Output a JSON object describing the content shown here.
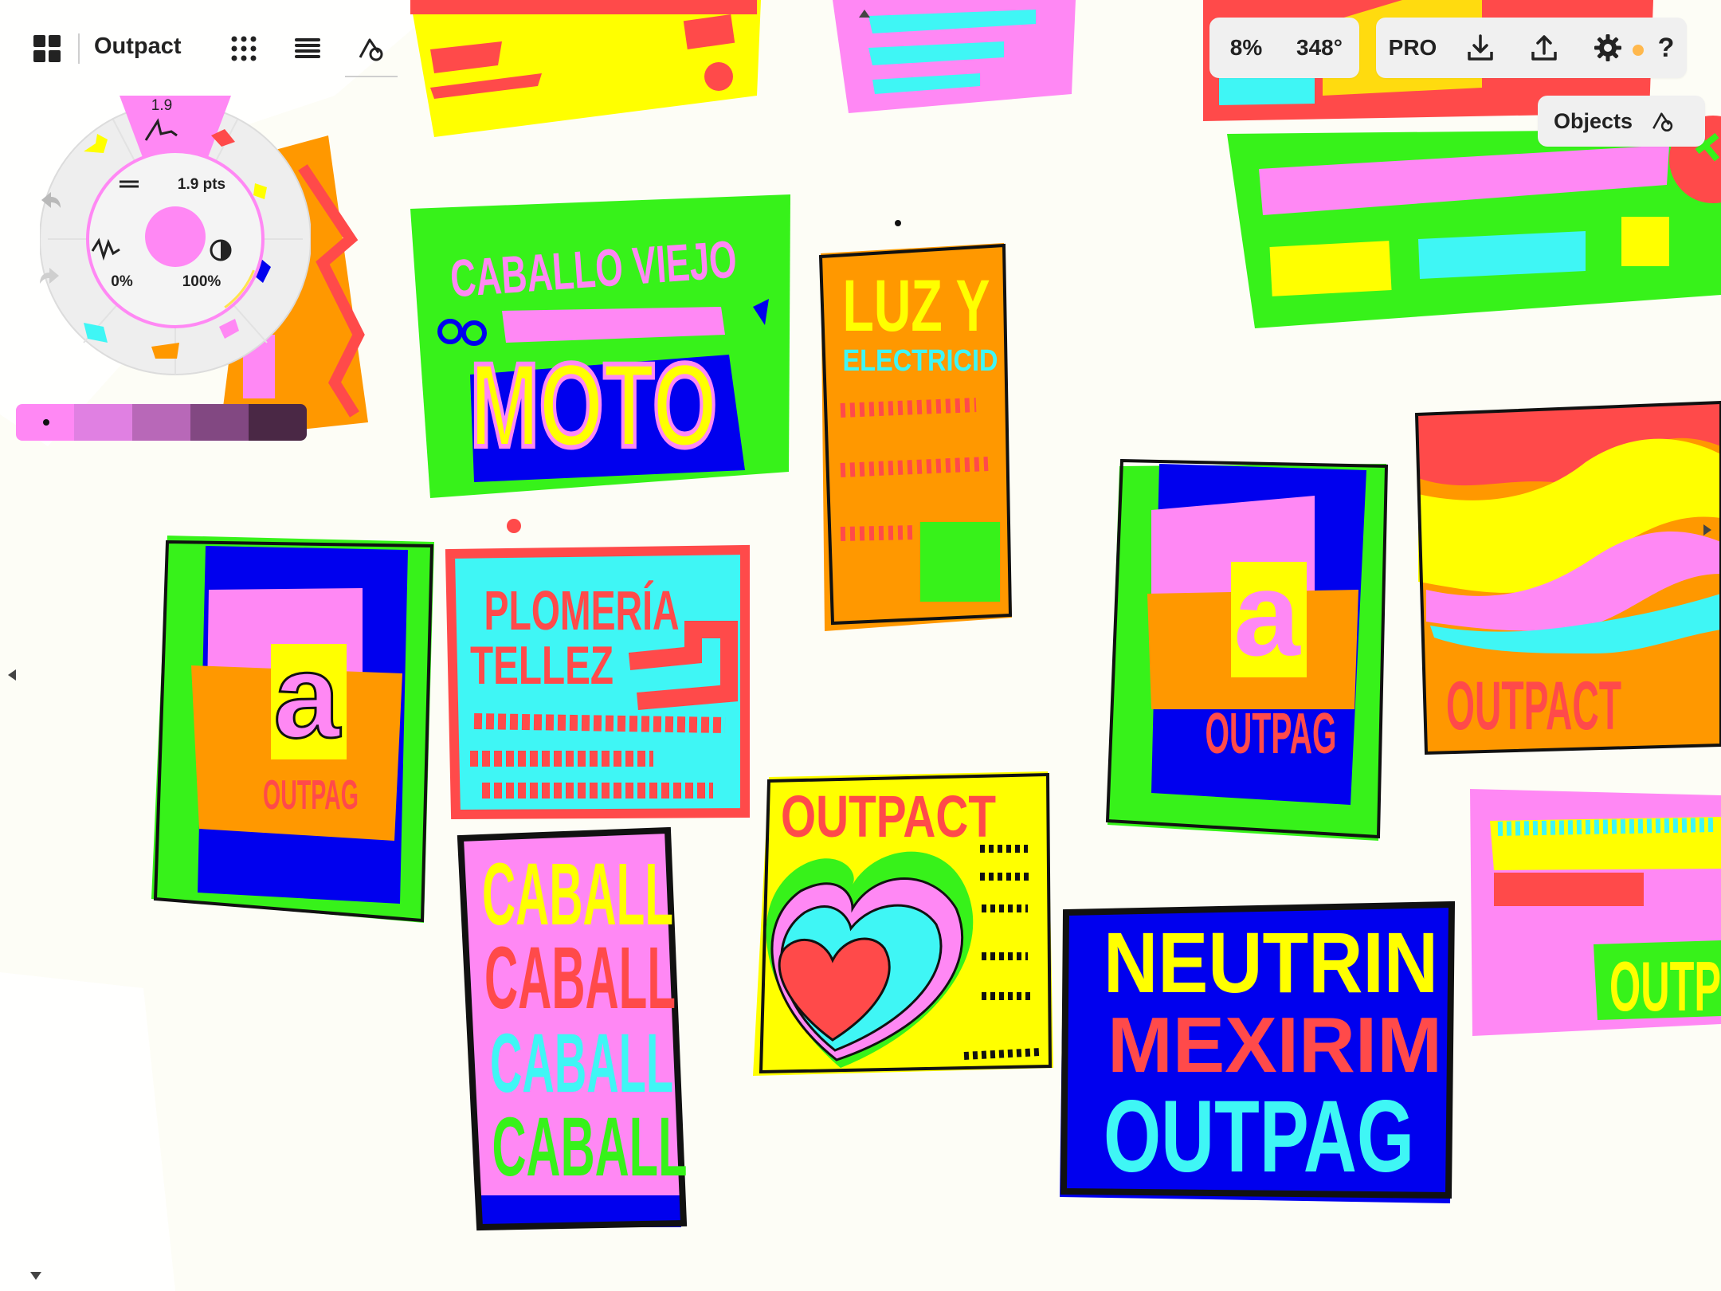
{
  "app": {
    "title": "Outpact"
  },
  "toolbar": {
    "zoom": "8%",
    "rotation": "348°",
    "pro_label": "PRO",
    "help_label": "?",
    "objects_label": "Objects"
  },
  "brush_wheel": {
    "size_value": "1.9",
    "size_label": "1.9 pts",
    "smoothing": "0%",
    "opacity": "100%",
    "current_color": "#ff88f4"
  },
  "palette": {
    "colors": [
      "#ff88f4",
      "#e080e2",
      "#b868b8",
      "#824882",
      "#4a2845"
    ]
  },
  "colors": {
    "green": "#37f21a",
    "pink": "#ff88f4",
    "yellow": "#ffff00",
    "orange": "#ff9800",
    "blue": "#0000ee",
    "red": "#ff4a4a",
    "cyan": "#3ff6f5",
    "ink": "#111111"
  },
  "posters": {
    "caballo_line1": "CABALLO VIEJO",
    "moto": "MOTO",
    "luz": "LUZ Y",
    "electricidad": "ELECTRICID",
    "plomeria_line1": "PLOMERÍA",
    "plomeria_line2": "TELLEZ",
    "outpag": "OUTPAG",
    "a_letter": "a",
    "caball": "CABALL",
    "outpact": "OUTPACT",
    "neutrin": "NEUTRIN",
    "mexirim": "MEXIRIM",
    "outp": "OUTP"
  }
}
